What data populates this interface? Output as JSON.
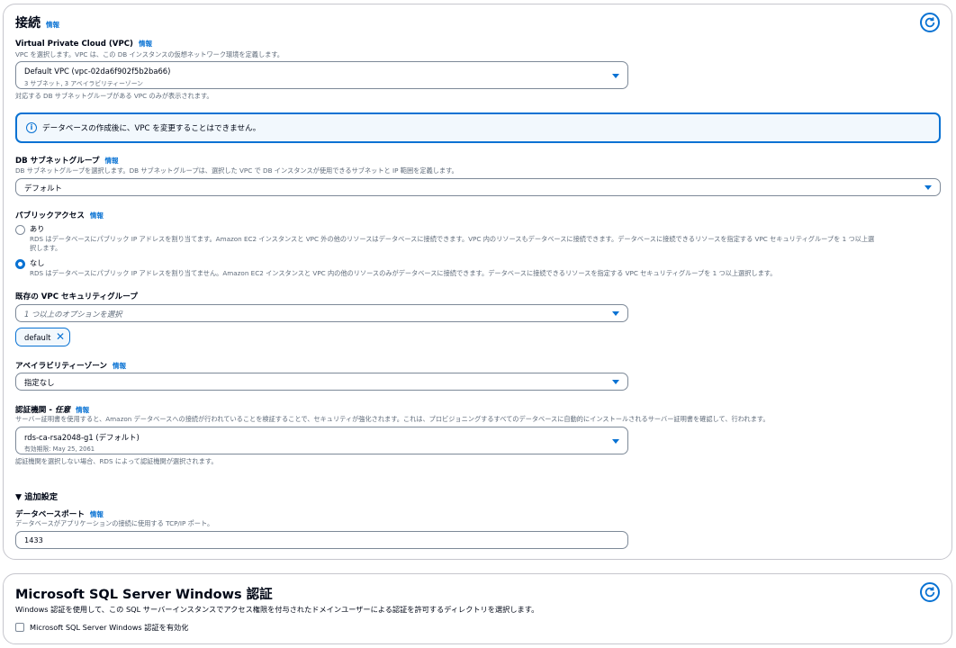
{
  "connectivity": {
    "title": "接続",
    "info": "情報",
    "vpc": {
      "label": "Virtual Private Cloud (VPC)",
      "info": "情報",
      "description": "VPC を選択します。VPC は、この DB インスタンスの仮想ネットワーク環境を定義します。",
      "value": "Default VPC (vpc-02da6f902f5b2ba66)",
      "sub": "3 サブネット, 3 アベイラビリティーゾーン",
      "hint": "対応する DB サブネットグループがある VPC のみが表示されます。"
    },
    "alert": "データベースの作成後に、VPC を変更することはできません。",
    "subnet_group": {
      "label": "DB サブネットグループ",
      "info": "情報",
      "description": "DB サブネットグループを選択します。DB サブネットグループは、選択した VPC で DB インスタンスが使用できるサブネットと IP 範囲を定義します。",
      "value": "デフォルト"
    },
    "public_access": {
      "label": "パブリックアクセス",
      "info": "情報",
      "yes_label": "あり",
      "yes_desc_1": "RDS はデータベースにパブリック IP アドレスを割り当てます。Amazon EC2 インスタンスと VPC 外の他のリソースはデータベースに接続できます。VPC 内のリソースもデータベースに接続できます。データベースに接続できるリソースを指定する VPC セキュリティグループを 1 つ以上選",
      "yes_desc_2": "択します。",
      "no_label": "なし",
      "no_desc": "RDS はデータベースにパブリック IP アドレスを割り当てません。Amazon EC2 インスタンスと VPC 内の他のリソースのみがデータベースに接続できます。データベースに接続できるリソースを指定する VPC セキュリティグループを 1 つ以上選択します。",
      "selected": "なし"
    },
    "security_group": {
      "label": "既存の VPC セキュリティグループ",
      "placeholder": "1 つ以上のオプションを選択",
      "token": "default"
    },
    "availability_zone": {
      "label": "アベイラビリティーゾーン",
      "info": "情報",
      "value": "指定なし"
    },
    "certificate": {
      "label": "認証機関 - ",
      "label_optional": "任意",
      "info": "情報",
      "description": "サーバー証明書を使用すると、Amazon データベースへの接続が行われていることを検証することで、セキュリティが強化されます。これは、プロビジョニングするすべてのデータベースに自動的にインストールされるサーバー証明書を確認して、行われます。",
      "value": "rds-ca-rsa2048-g1 (デフォルト)",
      "sub": "有効期限: May 25, 2061",
      "hint": "認証機関を選択しない場合、RDS によって認証機関が選択されます。"
    },
    "additional": {
      "title": "追加設定",
      "port_label": "データベースポート",
      "port_info": "情報",
      "port_description": "データベースがアプリケーションの接続に使用する TCP/IP ポート。",
      "port_value": "1433"
    }
  },
  "windows_auth": {
    "title": "Microsoft SQL Server Windows 認証",
    "description": "Windows 認証を使用して、この SQL サーバーインスタンスでアクセス権限を付与されたドメインユーザーによる認証を許可するディレクトリを選択します。",
    "checkbox_label": "Microsoft SQL Server Windows 認証を有効化",
    "checked": false
  },
  "colors": {
    "accent": "#0972d3",
    "text": "#000716",
    "muted": "#5f6b7a",
    "border": "#7d8998"
  }
}
